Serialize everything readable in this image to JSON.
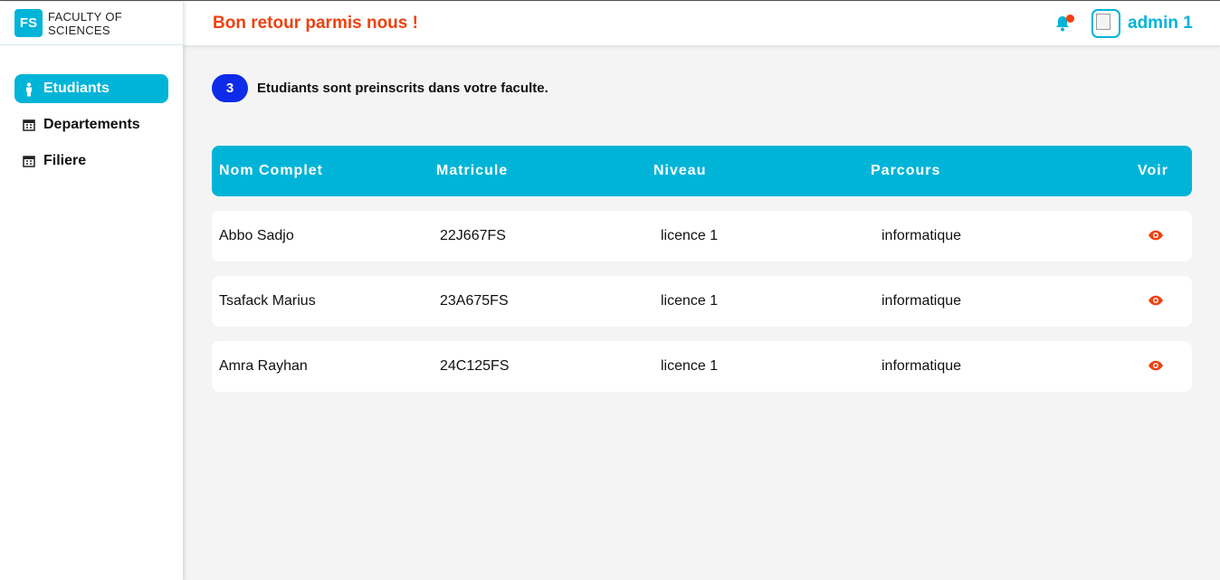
{
  "brand": {
    "logo": "FS",
    "name_line1": "FACULTY OF",
    "name_line2": "SCIENCES"
  },
  "sidebar": {
    "items": [
      {
        "label": "Etudiants",
        "icon": "person-icon",
        "active": true
      },
      {
        "label": "Departements",
        "icon": "calendar-icon",
        "active": false
      },
      {
        "label": "Filiere",
        "icon": "calendar-icon",
        "active": false
      }
    ]
  },
  "header": {
    "welcome": "Bon retour parmis nous !",
    "username": "admin 1",
    "notification_icon": "bell-icon"
  },
  "summary": {
    "count": "3",
    "text": "Etudiants sont preinscrits dans votre faculte."
  },
  "table": {
    "columns": [
      "Nom Complet",
      "Matricule",
      "Niveau",
      "Parcours",
      "Voir"
    ],
    "rows": [
      {
        "nom": "Abbo Sadjo",
        "matricule": "22J667FS",
        "niveau": "licence 1",
        "parcours": "informatique"
      },
      {
        "nom": "Tsafack Marius",
        "matricule": "23A675FS",
        "niveau": "licence 1",
        "parcours": "informatique"
      },
      {
        "nom": "Amra Rayhan",
        "matricule": "24C125FS",
        "niveau": "licence 1",
        "parcours": "informatique"
      }
    ]
  },
  "colors": {
    "accent": "#00b4d8",
    "warning": "#f0400f",
    "badge": "#0d2be8"
  }
}
